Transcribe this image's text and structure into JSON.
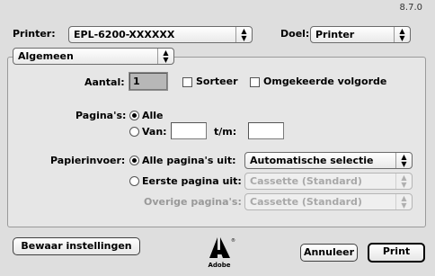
{
  "version": "8.7.0",
  "header": {
    "printer_label": "Printer:",
    "printer_value": "EPL-6200-XXXXXX",
    "doel_label": "Doel:",
    "doel_value": "Printer"
  },
  "section_popup": "Algemeen",
  "copies": {
    "label": "Aantal:",
    "value": "1",
    "collate_label": "Sorteer",
    "reverse_label": "Omgekeerde volgorde"
  },
  "pages": {
    "label": "Pagina's:",
    "all_label": "Alle",
    "from_label": "Van:",
    "to_label": "t/m:",
    "from_value": "",
    "to_value": ""
  },
  "paper": {
    "label": "Papierinvoer:",
    "all_pages_label": "Alle pagina's uit:",
    "all_pages_value": "Automatische selectie",
    "first_page_label": "Eerste pagina uit:",
    "first_page_value": "Cassette (Standard)",
    "other_pages_label": "Overige pagina's:",
    "other_pages_value": "Cassette (Standard)"
  },
  "buttons": {
    "save": "Bewaar instellingen",
    "cancel": "Annuleer",
    "print": "Print"
  },
  "logo": {
    "text": "Adobe"
  }
}
